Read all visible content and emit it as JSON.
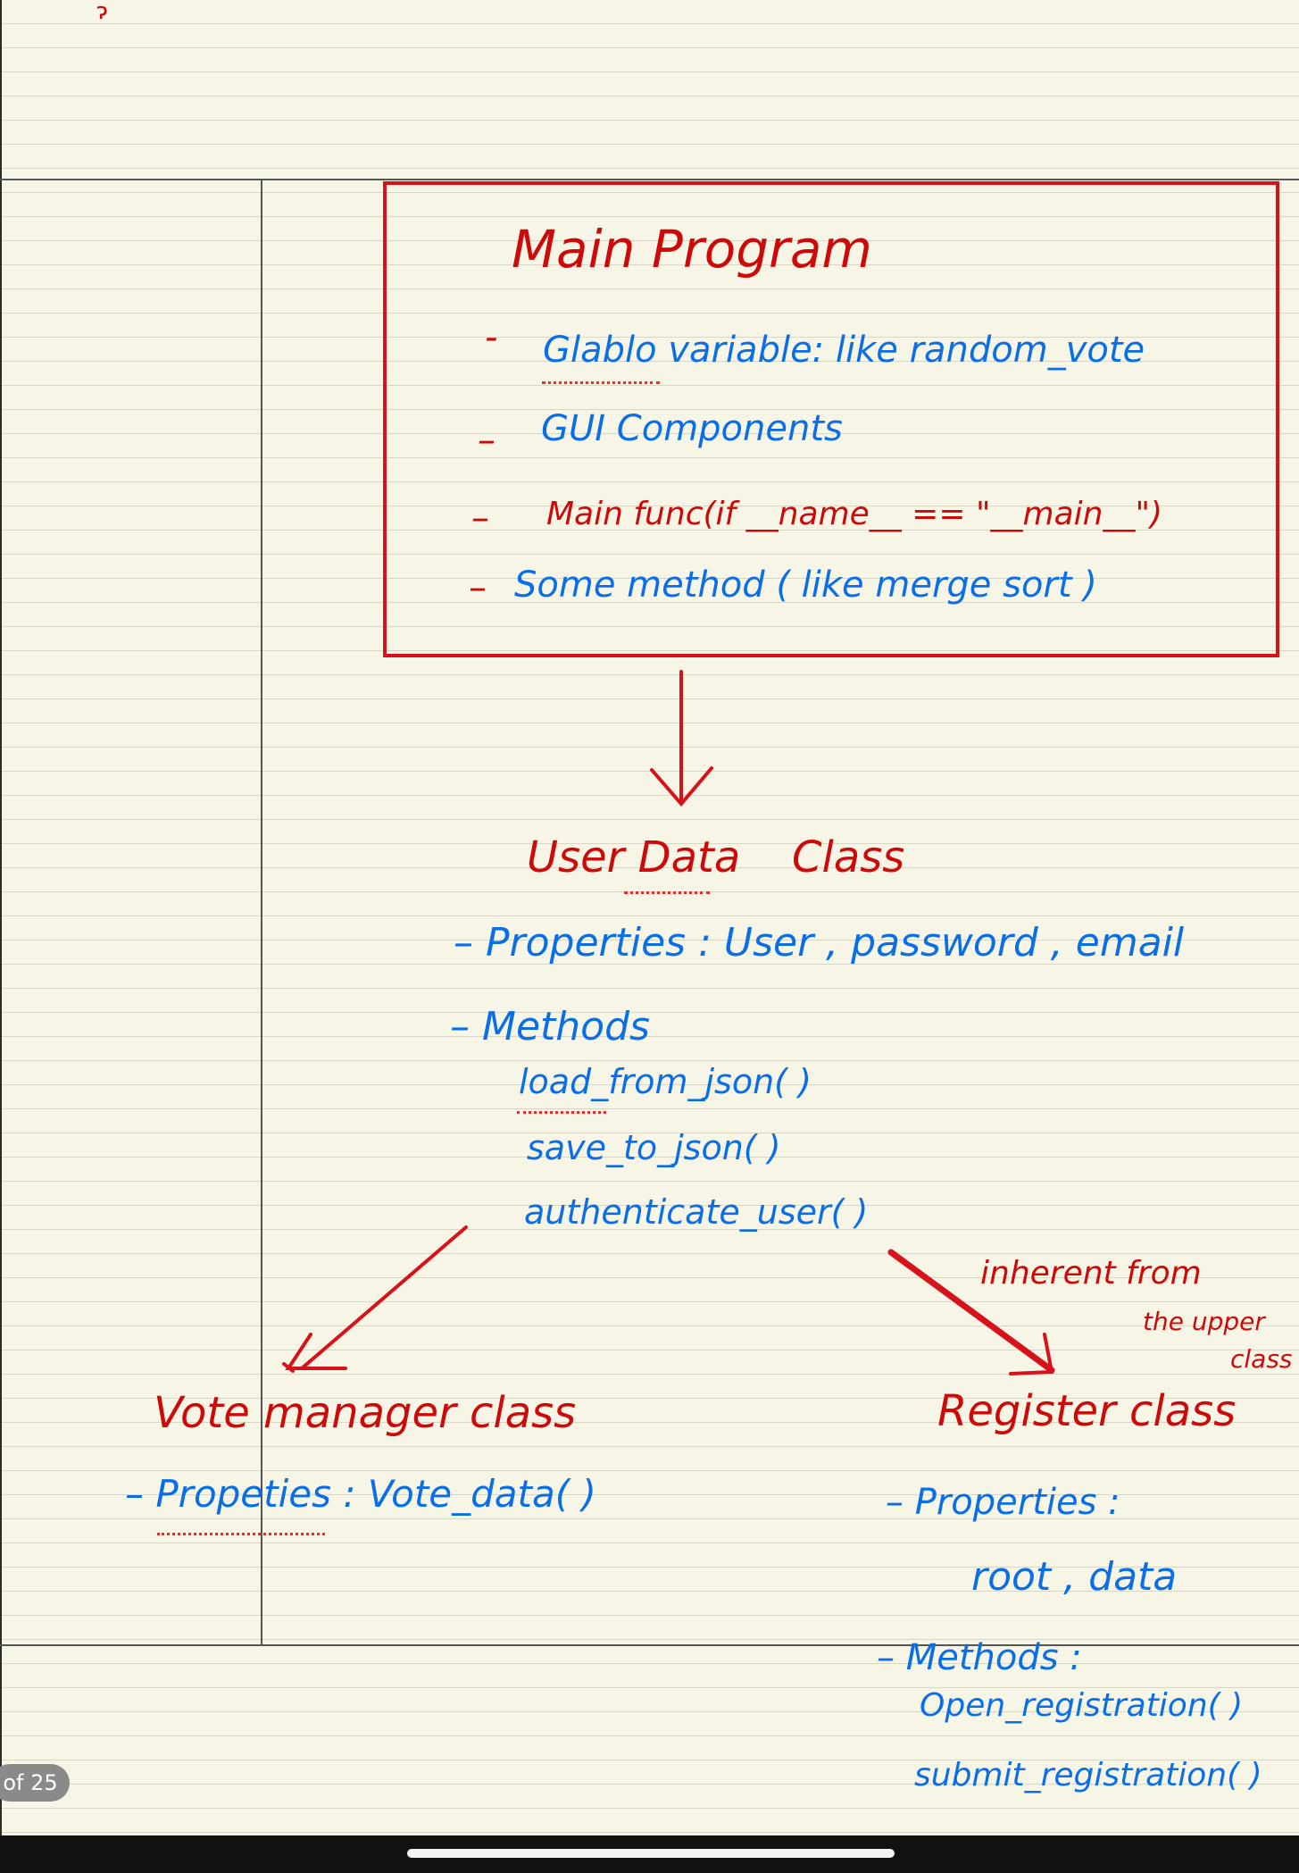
{
  "colors": {
    "red": "#cc0a0a",
    "blue": "#0a6ee8",
    "paper": "#f7f5e6"
  },
  "page_indicator": "of 25",
  "top_mark": "ɂ",
  "main_program": {
    "title": "Main Program",
    "items": [
      {
        "dash": "-",
        "text": "Glablo variable: like random_vote"
      },
      {
        "dash": "–",
        "text": "GUI Components"
      },
      {
        "dash": "–",
        "text": "Main func(if __name__ == \"__main__\")"
      },
      {
        "dash": "–",
        "text": "Some method ( like merge sort )"
      }
    ]
  },
  "user_data": {
    "title": "User Data",
    "title_suffix": "Class",
    "properties": "– Properties : User , password , email",
    "methods_label": "– Methods",
    "methods": [
      "load_from_json( )",
      "save_to_json( )",
      "authenticate_user( )"
    ]
  },
  "inherit_note": [
    "inherent from",
    "the upper",
    "class"
  ],
  "vote_manager": {
    "title": "Vote manager class",
    "properties": "– Propeties : Vote_data( )"
  },
  "register": {
    "title": "Register class",
    "properties_label": "– Properties :",
    "properties": "root , data",
    "methods_label": "– Methods :",
    "methods": [
      "Open_registration( )",
      "submit_registration( )"
    ]
  }
}
